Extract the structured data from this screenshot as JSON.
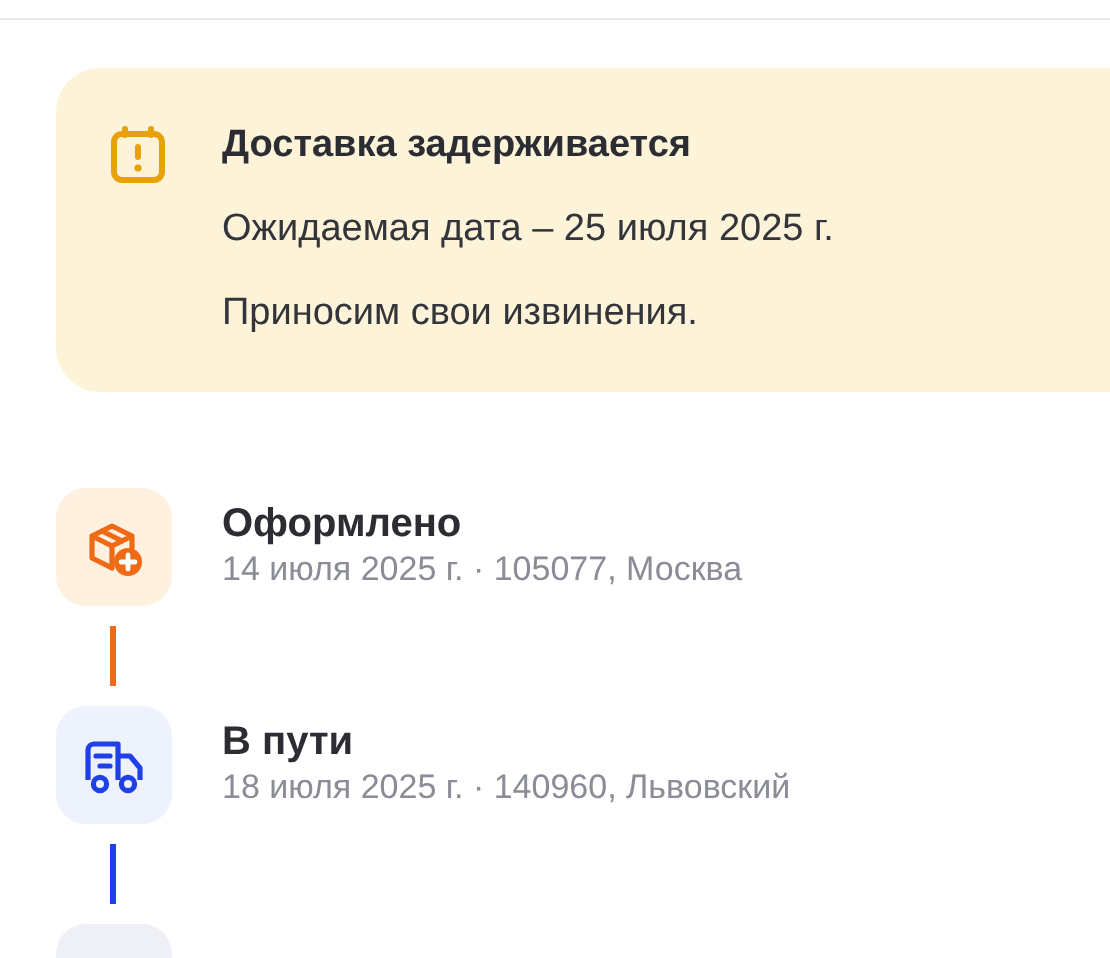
{
  "alert": {
    "title": "Доставка задерживается",
    "lines": [
      "Ожидаемая дата – 25 июля 2025 г.",
      "Приносим свои извинения."
    ]
  },
  "steps": [
    {
      "kind": "created",
      "color": "#ee6a14",
      "title": "Оформлено",
      "detail": "14 июля 2025 г. · 105077, Москва"
    },
    {
      "kind": "transit",
      "color": "#1f3fe8",
      "title": "В пути",
      "detail": "18 июля 2025 г. · 140960, Львовский"
    },
    {
      "kind": "pending"
    }
  ]
}
